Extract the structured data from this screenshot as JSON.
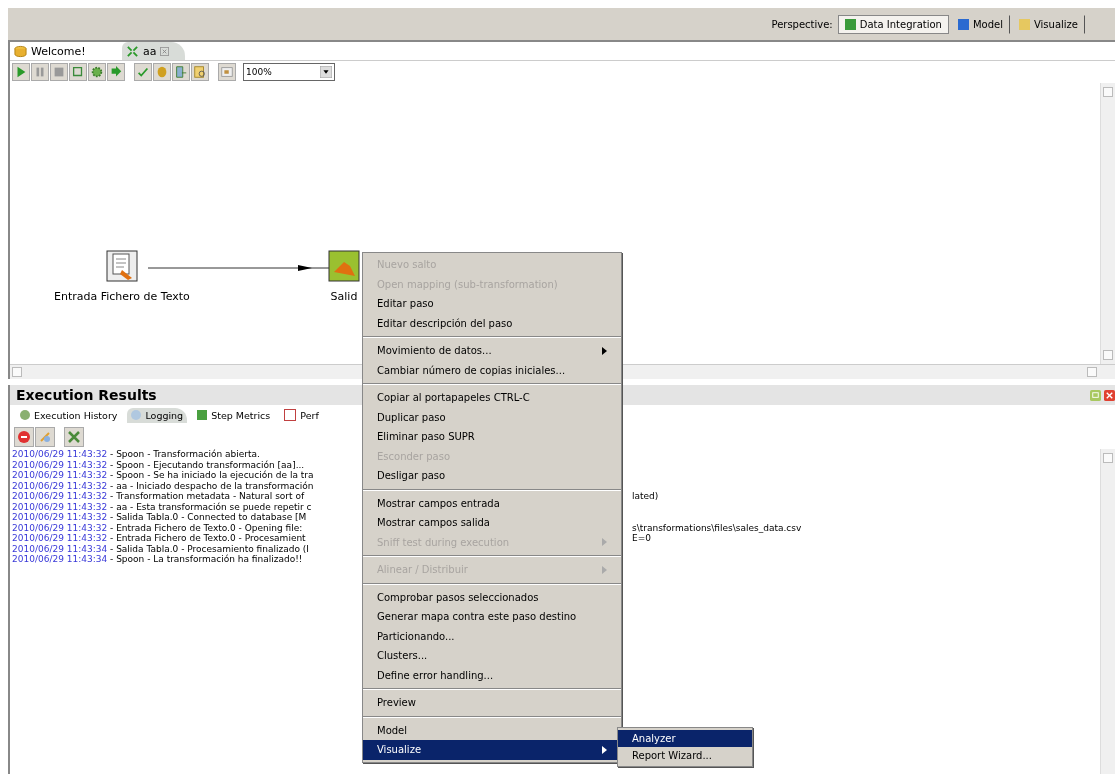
{
  "perspective": {
    "label": "Perspective:",
    "items": [
      {
        "label": "Data Integration",
        "selected": true,
        "kind": "di"
      },
      {
        "label": "Model",
        "selected": false,
        "kind": "model"
      },
      {
        "label": "Visualize",
        "selected": false,
        "kind": "viz"
      }
    ]
  },
  "editor_tabs": [
    {
      "label": "Welcome!",
      "selected": false,
      "closable": false,
      "kind": "welcome"
    },
    {
      "label": "aa",
      "selected": true,
      "closable": true,
      "kind": "trans"
    }
  ],
  "toolbar": {
    "zoom": "100%"
  },
  "canvas": {
    "nodes": [
      {
        "label": "Entrada Fichero de Texto",
        "kind": "input"
      },
      {
        "label": "Salid",
        "kind": "output"
      }
    ]
  },
  "results": {
    "title": "Execution Results",
    "tabs": [
      {
        "label": "Execution History",
        "selected": false,
        "kind": "history"
      },
      {
        "label": "Logging",
        "selected": true,
        "kind": "log"
      },
      {
        "label": "Step Metrics",
        "selected": false,
        "kind": "metrics"
      },
      {
        "label": "Perf",
        "selected": false,
        "kind": "perf"
      }
    ],
    "log": [
      {
        "time": "2010/06/29 11:43:32",
        "text": " - Spoon - Transformación abierta."
      },
      {
        "time": "2010/06/29 11:43:32",
        "text": " - Spoon - Ejecutando transformación [aa]..."
      },
      {
        "time": "2010/06/29 11:43:32",
        "text": " - Spoon - Se ha iniciado la ejecución de la tra"
      },
      {
        "time": "2010/06/29 11:43:32",
        "text": " - aa - Iniciado despacho de la transformación"
      },
      {
        "time": "2010/06/29 11:43:32",
        "text": " - Transformation metadata - Natural sort of",
        "tail": "lated)"
      },
      {
        "time": "2010/06/29 11:43:32",
        "text": " - aa - Esta transformación se puede repetir c"
      },
      {
        "time": "2010/06/29 11:43:32",
        "text": " - Salida Tabla.0 - Connected to database [M"
      },
      {
        "time": "2010/06/29 11:43:32",
        "text": " - Entrada Fichero de Texto.0 - Opening file:",
        "tail": "s\\transformations\\files\\sales_data.csv"
      },
      {
        "time": "2010/06/29 11:43:32",
        "text": " - Entrada Fichero de Texto.0 - Procesamient",
        "tail": "E=0"
      },
      {
        "time": "2010/06/29 11:43:34",
        "text": " - Salida Tabla.0 - Procesamiento finalizado (I"
      },
      {
        "time": "2010/06/29 11:43:34",
        "text": " - Spoon - La transformación ha finalizado!!"
      }
    ]
  },
  "context_menu": {
    "items": [
      {
        "kind": "item",
        "label": "Nuevo salto",
        "disabled": true,
        "submenu": false,
        "selected": false
      },
      {
        "kind": "item",
        "label": "Open mapping (sub-transformation)",
        "disabled": true,
        "submenu": false,
        "selected": false
      },
      {
        "kind": "item",
        "label": "Editar paso",
        "disabled": false,
        "submenu": false,
        "selected": false
      },
      {
        "kind": "item",
        "label": "Editar descripción del paso",
        "disabled": false,
        "submenu": false,
        "selected": false
      },
      {
        "kind": "separator"
      },
      {
        "kind": "item",
        "label": "Movimiento de datos...",
        "disabled": false,
        "submenu": true,
        "selected": false
      },
      {
        "kind": "item",
        "label": "Cambiar número de copias iniciales...",
        "disabled": false,
        "submenu": false,
        "selected": false
      },
      {
        "kind": "separator"
      },
      {
        "kind": "item",
        "label": "Copiar al portapapeles CTRL-C",
        "disabled": false,
        "submenu": false,
        "selected": false
      },
      {
        "kind": "item",
        "label": "Duplicar paso",
        "disabled": false,
        "submenu": false,
        "selected": false
      },
      {
        "kind": "item",
        "label": "Eliminar paso SUPR",
        "disabled": false,
        "submenu": false,
        "selected": false
      },
      {
        "kind": "item",
        "label": "Esconder paso",
        "disabled": true,
        "submenu": false,
        "selected": false
      },
      {
        "kind": "item",
        "label": "Desligar paso",
        "disabled": false,
        "submenu": false,
        "selected": false
      },
      {
        "kind": "separator"
      },
      {
        "kind": "item",
        "label": "Mostrar campos entrada",
        "disabled": false,
        "submenu": false,
        "selected": false
      },
      {
        "kind": "item",
        "label": "Mostrar campos salida",
        "disabled": false,
        "submenu": false,
        "selected": false
      },
      {
        "kind": "item",
        "label": "Sniff test during execution",
        "disabled": true,
        "submenu": true,
        "selected": false
      },
      {
        "kind": "separator"
      },
      {
        "kind": "item",
        "label": "Alinear / Distribuir",
        "disabled": true,
        "submenu": true,
        "selected": false
      },
      {
        "kind": "separator"
      },
      {
        "kind": "item",
        "label": "Comprobar pasos seleccionados",
        "disabled": false,
        "submenu": false,
        "selected": false
      },
      {
        "kind": "item",
        "label": "Generar mapa contra este paso destino",
        "disabled": false,
        "submenu": false,
        "selected": false
      },
      {
        "kind": "item",
        "label": "Particionando...",
        "disabled": false,
        "submenu": false,
        "selected": false
      },
      {
        "kind": "item",
        "label": "Clusters...",
        "disabled": false,
        "submenu": false,
        "selected": false
      },
      {
        "kind": "item",
        "label": "Define error handling...",
        "disabled": false,
        "submenu": false,
        "selected": false
      },
      {
        "kind": "separator"
      },
      {
        "kind": "item",
        "label": "Preview",
        "disabled": false,
        "submenu": false,
        "selected": false
      },
      {
        "kind": "separator"
      },
      {
        "kind": "item",
        "label": "Model",
        "disabled": false,
        "submenu": false,
        "selected": false
      },
      {
        "kind": "item",
        "label": "Visualize",
        "disabled": false,
        "submenu": true,
        "selected": true
      }
    ],
    "submenu": [
      {
        "label": "Analyzer",
        "selected": true
      },
      {
        "label": "Report Wizard...",
        "selected": false
      }
    ]
  }
}
